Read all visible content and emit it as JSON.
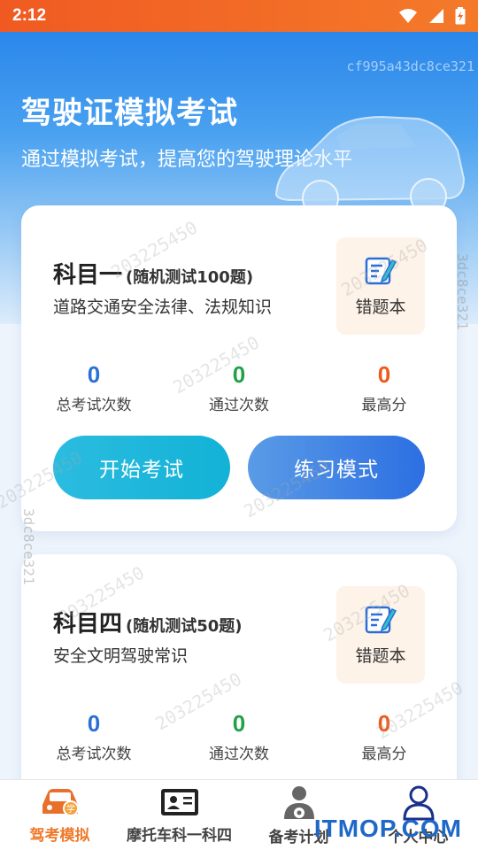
{
  "status": {
    "time": "2:12"
  },
  "hero": {
    "watermark_id": "cf995a43dc8ce321",
    "title": "驾驶证模拟考试",
    "subtitle": "通过模拟考试，提高您的驾驶理论水平"
  },
  "watermarks": {
    "text": "203225450",
    "side": "3dc8ce321"
  },
  "cards": [
    {
      "subject": "科目一",
      "note": "(随机测试100题)",
      "desc": "道路交通安全法律、法规知识",
      "error_book": "错题本",
      "stats": [
        {
          "value": "0",
          "label": "总考试次数"
        },
        {
          "value": "0",
          "label": "通过次数"
        },
        {
          "value": "0",
          "label": "最高分"
        }
      ],
      "start_label": "开始考试",
      "practice_label": "练习模式"
    },
    {
      "subject": "科目四",
      "note": "(随机测试50题)",
      "desc": "安全文明驾驶常识",
      "error_book": "错题本",
      "stats": [
        {
          "value": "0",
          "label": "总考试次数"
        },
        {
          "value": "0",
          "label": "通过次数"
        },
        {
          "value": "0",
          "label": "最高分"
        }
      ]
    }
  ],
  "tabs": [
    {
      "label": "驾考模拟",
      "icon": "car-icon",
      "active": true
    },
    {
      "label": "摩托车科一科四",
      "icon": "id-card-icon",
      "active": false
    },
    {
      "label": "备考计划",
      "icon": "driver-icon",
      "active": false
    },
    {
      "label": "个人中心",
      "icon": "user-icon",
      "active": false
    }
  ],
  "brand": "ITMOP.COM",
  "colors": {
    "accent": "#ef7a2a",
    "blue": "#2b6fd6",
    "green": "#21a049",
    "orange": "#ec5a1c"
  }
}
